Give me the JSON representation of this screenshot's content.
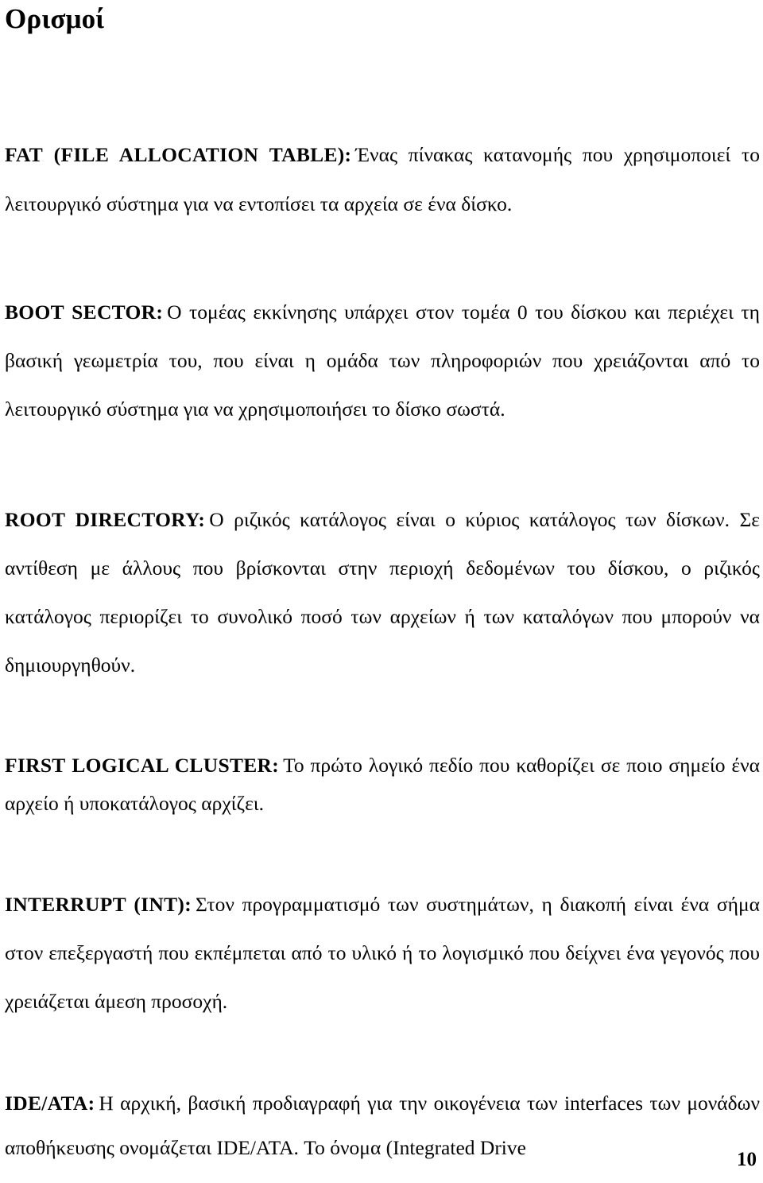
{
  "document": {
    "title": "Ορισμοί",
    "page_number": "10",
    "language": "el"
  },
  "definitions": [
    {
      "id": "fat",
      "term": "FAT (FILE ALLOCATION TABLE):",
      "body": "Ένας πίνακας κατανομής που χρησιμοποιεί το λειτουργικό σύστημα για να εντοπίσει τα αρχεία σε ένα δίσκο."
    },
    {
      "id": "boot-sector",
      "term": "BOOT SECTOR:",
      "body": "Ο τομέας εκκίνησης υπάρχει στον τομέα 0 του δίσκου και περιέχει τη βασική γεωμετρία του, που είναι η ομάδα των πληροφοριών που χρειάζονται από το λειτουργικό σύστημα για να χρησιμοποιήσει το δίσκο σωστά."
    },
    {
      "id": "root-directory",
      "term": "ROOT DIRECTORY:",
      "body": "Ο ριζικός κατάλογος είναι ο κύριος κατάλογος των δίσκων. Σε αντίθεση με άλλους που βρίσκονται στην περιοχή δεδομένων του δίσκου, ο ριζικός κατάλογος περιορίζει το συνολικό ποσό των αρχείων ή των καταλόγων που μπορούν να δημιουργηθούν."
    },
    {
      "id": "first-logical-cluster",
      "term": "FIRST LOGICAL CLUSTER:",
      "body": "Το πρώτο λογικό πεδίο που καθορίζει σε ποιο σημείο ένα αρχείο ή υποκατάλογος αρχίζει."
    },
    {
      "id": "interrupt",
      "term": "INTERRUPT (INT):",
      "body": "Στον προγραμματισμό των συστημάτων, η διακοπή είναι ένα σήμα στον επεξεργαστή που εκπέμπεται από το υλικό ή το λογισμικό που δείχνει ένα γεγονός που χρειάζεται άμεση προσοχή."
    },
    {
      "id": "ide-ata",
      "term": "IDE/ATA:",
      "body": "Η αρχική, βασική προδιαγραφή για την οικογένεια των interfaces των μονάδων αποθήκευσης ονομάζεται IDE/ATA. Το όνομα (Integrated Drive"
    }
  ]
}
